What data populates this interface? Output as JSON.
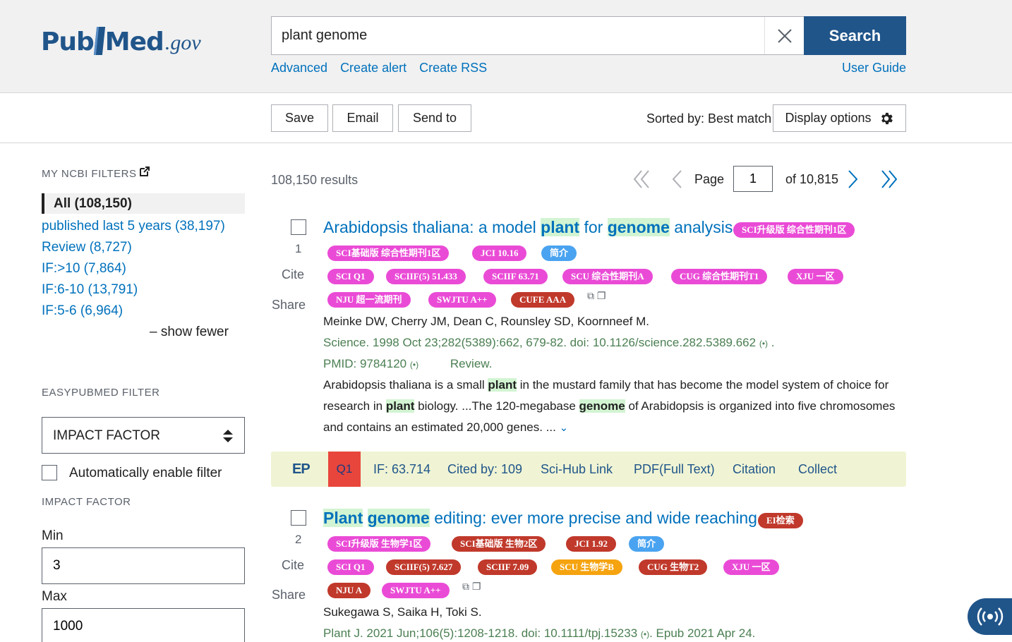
{
  "header": {
    "logo_pub": "Pub",
    "logo_med": "Med",
    "logo_gov": ".gov",
    "search_value": "plant genome",
    "search_button": "Search",
    "links": [
      "Advanced",
      "Create alert",
      "Create RSS"
    ],
    "user_guide": "User Guide"
  },
  "actions": {
    "save": "Save",
    "email": "Email",
    "send_to": "Send to",
    "sorted_by": "Sorted by: Best match",
    "display_options": "Display options"
  },
  "sidebar": {
    "my_filters_heading": "MY NCBI FILTERS",
    "all_filter": "All (108,150)",
    "filters": [
      "published last 5 years (38,197)",
      "Review (8,727)",
      "IF:>10 (7,864)",
      "IF:6-10 (13,791)",
      "IF:5-6 (6,964)"
    ],
    "show_fewer": "show fewer",
    "easypubmed_heading": "EASYPUBMED FILTER",
    "select_value": "IMPACT FACTOR",
    "auto_enable": "Automatically enable filter",
    "impact_heading": "IMPACT FACTOR",
    "min_label": "Min",
    "min_value": "3",
    "max_label": "Max",
    "max_value": "1000"
  },
  "results": {
    "count": "108,150 results",
    "page_label": "Page",
    "page_value": "1",
    "page_of": "of 10,815"
  },
  "articles": [
    {
      "num": "1",
      "cite": "Cite",
      "share": "Share",
      "title_parts": [
        "Arabidopsis thaliana: a model ",
        "plant",
        " for ",
        "genome",
        " analysis."
      ],
      "badges": [
        "SCI升级版 综合性期刊1区",
        "SCI基础版 综合性期刊1区",
        "JCI 10.16",
        "简介",
        "SCI Q1",
        "SCIIF(5) 51.433",
        "SCIIF 63.71",
        "SCU 综合性期刊A",
        "CUG 综合性期刊T1",
        "XJU 一区",
        "NJU 超一流期刊",
        "SWJTU A++",
        "CUFE AAA"
      ],
      "authors": "Meinke DW, Cherry JM, Dean C, Rounsley SD, Koornneef M.",
      "citation": "Science. 1998 Oct 23;282(5389):662, 679-82. doi: 10.1126/science.282.5389.662",
      "pmid": "PMID: 9784120",
      "type": "Review.",
      "snippet_parts": [
        "Arabidopsis thaliana is a small ",
        "plant",
        " in the mustard family that has become the model system of choice for research in ",
        "plant",
        " biology. ...The 120-megabase ",
        "genome",
        " of Arabidopsis is organized into five chromosomes and contains an estimated 20,000 genes. ..."
      ]
    },
    {
      "num": "2",
      "cite": "Cite",
      "share": "Share",
      "title_parts": [
        "Plant",
        " ",
        "genome",
        " editing: ever more precise and wide reaching."
      ],
      "badges": [
        "EI检索",
        "SCI升级版 生物学1区",
        "SCI基础版 生物2区",
        "JCI 1.92",
        "简介",
        "SCI Q1",
        "SCIIF(5) 7.627",
        "SCIIF 7.09",
        "SCU 生物学B",
        "CUG 生物T2",
        "XJU 一区",
        "NJU A",
        "SWJTU A++"
      ],
      "authors": "Sukegawa S, Saika H, Toki S.",
      "citation": "Plant J. 2021 Jun;106(5):1208-1218. doi: 10.1111/tpj.15233",
      "citation_end": ". Epub 2021 Apr 24."
    }
  ],
  "ep_bar": {
    "logo": "EP",
    "q1": "Q1",
    "if": "IF: 63.714",
    "cited": "Cited by: 109",
    "scihub": "Sci-Hub Link",
    "pdf": "PDF(Full Text)",
    "citation": "Citation",
    "collect": "Collect"
  },
  "colors": {
    "brand": "#20558a",
    "link": "#0071bc",
    "badge_pink": "#ea4bd6",
    "badge_red": "#c0392b",
    "badge_blue": "#4aa3f0",
    "badge_orange": "#f5a30f",
    "highlight": "#d2f4d2",
    "ep_bar": "#f0f4d4"
  }
}
